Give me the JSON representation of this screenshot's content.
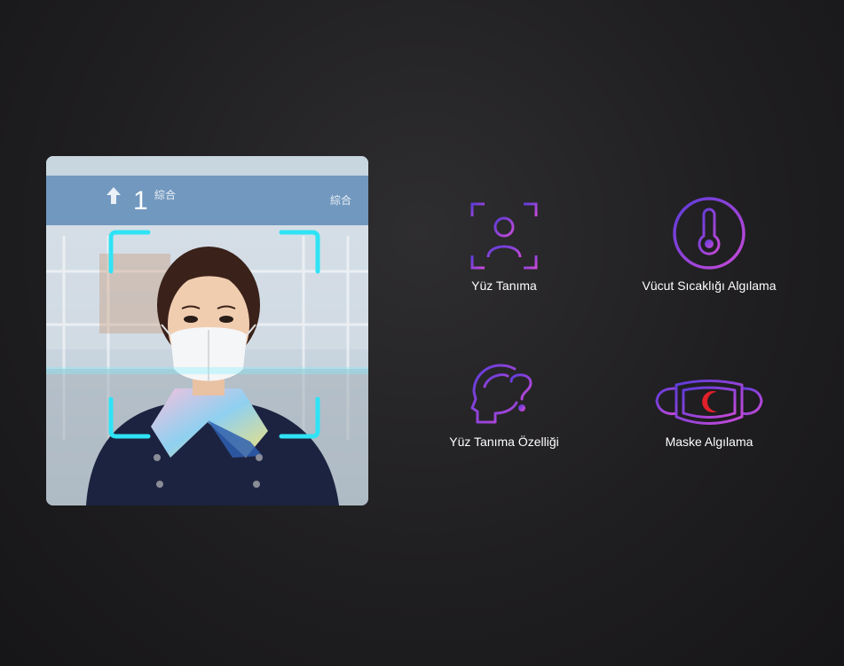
{
  "features": [
    {
      "label": "Yüz Tanıma",
      "icon": "face-scan-icon"
    },
    {
      "label": "Vücut Sıcaklığı Algılama",
      "icon": "thermometer-icon"
    },
    {
      "label": "Yüz Tanıma Özelliği",
      "icon": "head-question-icon"
    },
    {
      "label": "Maske Algılama",
      "icon": "face-mask-icon"
    }
  ],
  "photo": {
    "sign_number": "1",
    "sign_text_left": "綜合",
    "sign_text_right": "綜合"
  },
  "colors": {
    "icon_gradient_start": "#5b3cd9",
    "icon_gradient_end": "#c84ad8",
    "scan_frame": "#2fe3f5",
    "mask_accent": "#e0202a"
  }
}
